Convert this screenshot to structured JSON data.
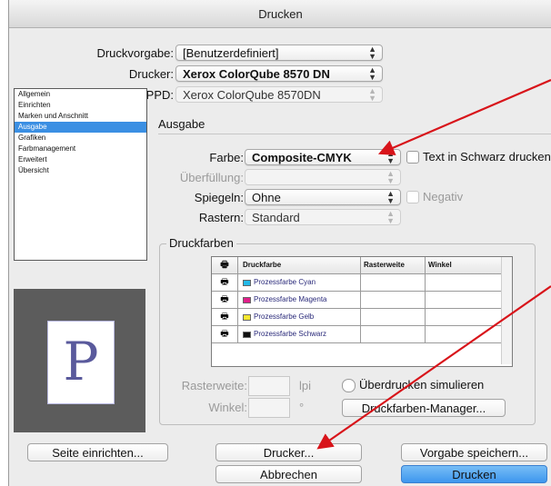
{
  "window": {
    "title": "Drucken"
  },
  "top": {
    "preset_label": "Druckvorgabe:",
    "preset_value": "[Benutzerdefiniert]",
    "printer_label": "Drucker:",
    "printer_value": "Xerox ColorQube 8570 DN",
    "ppd_label": "PPD:",
    "ppd_value": "Xerox ColorQube 8570DN"
  },
  "sidebar": {
    "items": [
      {
        "label": "Allgemein"
      },
      {
        "label": "Einrichten"
      },
      {
        "label": "Marken und Anschnitt"
      },
      {
        "label": "Ausgabe",
        "selected": true
      },
      {
        "label": "Grafiken"
      },
      {
        "label": "Farbmanagement"
      },
      {
        "label": "Erweitert"
      },
      {
        "label": "Übersicht"
      }
    ]
  },
  "preview": {
    "glyph": "P"
  },
  "ausgabe": {
    "heading": "Ausgabe",
    "farbe_label": "Farbe:",
    "farbe_value": "Composite-CMYK",
    "text_schwarz_label": "Text in Schwarz drucken",
    "ueberfuellung_label": "Überfüllung:",
    "ueberfuellung_value": "",
    "spiegeln_label": "Spiegeln:",
    "spiegeln_value": "Ohne",
    "negativ_label": "Negativ",
    "rastern_label": "Rastern:",
    "rastern_value": "Standard"
  },
  "druckfarben": {
    "title": "Druckfarben",
    "columns": [
      "Druckfarbe",
      "Rasterweite",
      "Winkel"
    ],
    "rows": [
      {
        "name": "Prozessfarbe Cyan",
        "color": "#22b8e8"
      },
      {
        "name": "Prozessfarbe Magenta",
        "color": "#e0208a"
      },
      {
        "name": "Prozessfarbe Gelb",
        "color": "#f5e830"
      },
      {
        "name": "Prozessfarbe Schwarz",
        "color": "#111111"
      }
    ],
    "rasterweite_label": "Rasterweite:",
    "rasterweite_unit": "lpi",
    "winkel_label": "Winkel:",
    "winkel_unit": "°",
    "ueberdrucken_label": "Überdrucken simulieren",
    "manager_button": "Druckfarben-Manager..."
  },
  "buttons": {
    "seite_einrichten": "Seite einrichten...",
    "drucker": "Drucker...",
    "vorgabe_speichern": "Vorgabe speichern...",
    "abbrechen": "Abbrechen",
    "drucken": "Drucken"
  },
  "colors": {
    "accent": "#3b8fe3",
    "annotation_arrow": "#d8141a"
  }
}
